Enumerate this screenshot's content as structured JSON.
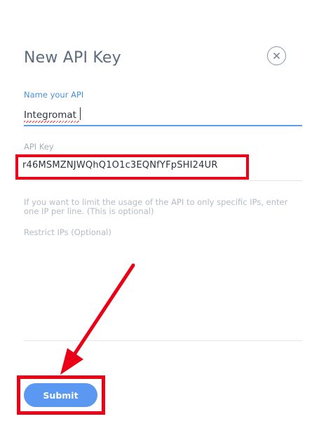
{
  "dialog": {
    "title": "New API Key",
    "close_icon": "close-icon"
  },
  "form": {
    "name_label": "Name your API",
    "name_value": "Integromat",
    "key_label": "API Key",
    "key_value": "r46MSMZNJWQhQ1O1c3EQNfYFpSHI24UR",
    "hint": "If you want to limit the usage of the API to only specific IPs, enter one IP per line. (This is optional)",
    "ips_label": "Restrict IPs (Optional)",
    "ips_value": ""
  },
  "actions": {
    "submit_label": "Submit"
  },
  "colors": {
    "accent": "#5b98f2",
    "highlight": "#ea0017",
    "input_focus": "#5aa0e6"
  }
}
